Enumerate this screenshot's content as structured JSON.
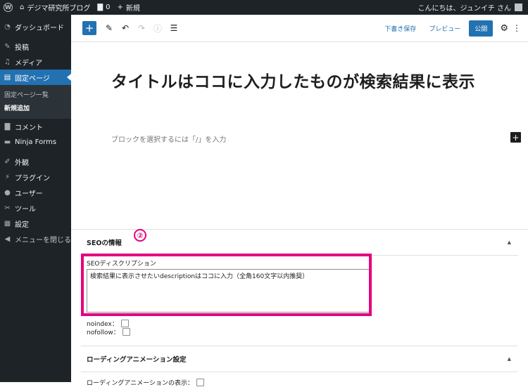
{
  "adminbar": {
    "site_name": "デジマ研究所ブログ",
    "comments_count": "0",
    "new_label": "新規",
    "greeting": "こんにちは、ジュンイチ さん"
  },
  "sidebar": {
    "items": [
      {
        "label": "ダッシュボード",
        "icon": "dashboard-icon"
      },
      {
        "label": "投稿",
        "icon": "pin-icon"
      },
      {
        "label": "メディア",
        "icon": "media-icon"
      },
      {
        "label": "固定ページ",
        "icon": "page-icon"
      },
      {
        "label": "コメント",
        "icon": "comment-icon"
      },
      {
        "label": "Ninja Forms",
        "icon": "forms-icon"
      },
      {
        "label": "外観",
        "icon": "brush-icon"
      },
      {
        "label": "プラグイン",
        "icon": "plugin-icon"
      },
      {
        "label": "ユーザー",
        "icon": "user-icon"
      },
      {
        "label": "ツール",
        "icon": "wrench-icon"
      },
      {
        "label": "設定",
        "icon": "settings-icon"
      },
      {
        "label": "メニューを閉じる",
        "icon": "collapse-icon"
      }
    ],
    "submenu": [
      "固定ページ一覧",
      "新規追加"
    ]
  },
  "toolbar": {
    "add_label": "+",
    "save_draft": "下書き保存",
    "preview": "プレビュー",
    "publish": "公開"
  },
  "editor": {
    "title": "タイトルはココに入力したものが検索結果に表示",
    "block_placeholder": "ブロックを選択するには「/」を入力"
  },
  "seo_panel": {
    "heading": "SEOの情報",
    "description_label": "SEOディスクリプション",
    "description_value": "検索結果に表示させたいdescriptionはココに入力（全角160文字以内推奨）",
    "noindex_label": "noindex：",
    "nofollow_label": "nofollow："
  },
  "animation_panel": {
    "heading": "ローディングアニメーション設定",
    "show_label": "ローディングアニメーションの表示："
  },
  "annotation": {
    "marker": "②",
    "color": "#e5007f"
  },
  "colors": {
    "accent": "#2271b1",
    "admin_dark": "#1d2327"
  }
}
